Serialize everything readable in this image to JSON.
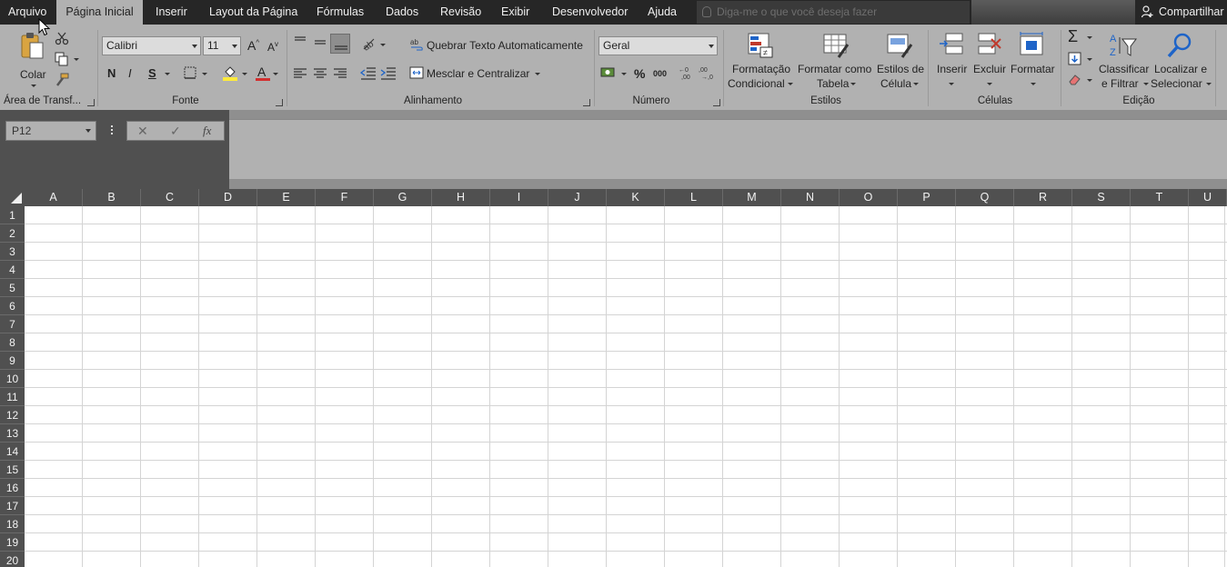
{
  "tabs": [
    {
      "label": "Arquivo",
      "active": false
    },
    {
      "label": "Página Inicial",
      "active": true
    },
    {
      "label": "Inserir",
      "active": false
    },
    {
      "label": "Layout da Página",
      "active": false
    },
    {
      "label": "Fórmulas",
      "active": false
    },
    {
      "label": "Dados",
      "active": false
    },
    {
      "label": "Revisão",
      "active": false
    },
    {
      "label": "Exibir",
      "active": false
    },
    {
      "label": "Desenvolvedor",
      "active": false
    },
    {
      "label": "Ajuda",
      "active": false
    }
  ],
  "tell_me": {
    "placeholder": "Diga-me o que você deseja fazer"
  },
  "share_label": "Compartilhar",
  "ribbon": {
    "clipboard": {
      "paste_label": "Colar",
      "group_label": "Área de Transf..."
    },
    "font": {
      "font_name": "Calibri",
      "font_size": "11",
      "bold": "N",
      "italic": "I",
      "underline": "S",
      "grow": "A",
      "shrink": "A",
      "color_letter": "A",
      "group_label": "Fonte"
    },
    "alignment": {
      "wrap_label": "Quebrar Texto Automaticamente",
      "merge_label": "Mesclar e Centralizar",
      "group_label": "Alinhamento"
    },
    "number": {
      "format": "Geral",
      "percent": "%",
      "thousands": "000",
      "group_label": "Número"
    },
    "styles": {
      "cond_line1": "Formatação",
      "cond_line2": "Condicional",
      "table_line1": "Formatar como",
      "table_line2": "Tabela",
      "cell_line1": "Estilos de",
      "cell_line2": "Célula",
      "group_label": "Estilos"
    },
    "cells": {
      "insert_label": "Inserir",
      "delete_label": "Excluir",
      "format_label": "Formatar",
      "group_label": "Células"
    },
    "editing": {
      "sort_line1": "Classificar",
      "sort_line2": "e Filtrar",
      "find_line1": "Localizar e",
      "find_line2": "Selecionar",
      "group_label": "Edição"
    }
  },
  "formula_bar": {
    "name_box": "P12",
    "cancel": "✕",
    "enter": "✓",
    "fx": "fx"
  },
  "columns": [
    "A",
    "B",
    "C",
    "D",
    "E",
    "F",
    "G",
    "H",
    "I",
    "J",
    "K",
    "L",
    "M",
    "N",
    "O",
    "P",
    "Q",
    "R",
    "S",
    "T",
    "U"
  ],
  "rows": [
    "1",
    "2",
    "3",
    "4",
    "5",
    "6",
    "7",
    "8",
    "9",
    "10",
    "11",
    "12",
    "13",
    "14",
    "15",
    "16",
    "17",
    "18",
    "19",
    "20"
  ],
  "colors": {
    "tabbar": "#262626",
    "ribbon": "#b1b1b1",
    "header": "#505050",
    "grid": "#d4d4d4"
  }
}
